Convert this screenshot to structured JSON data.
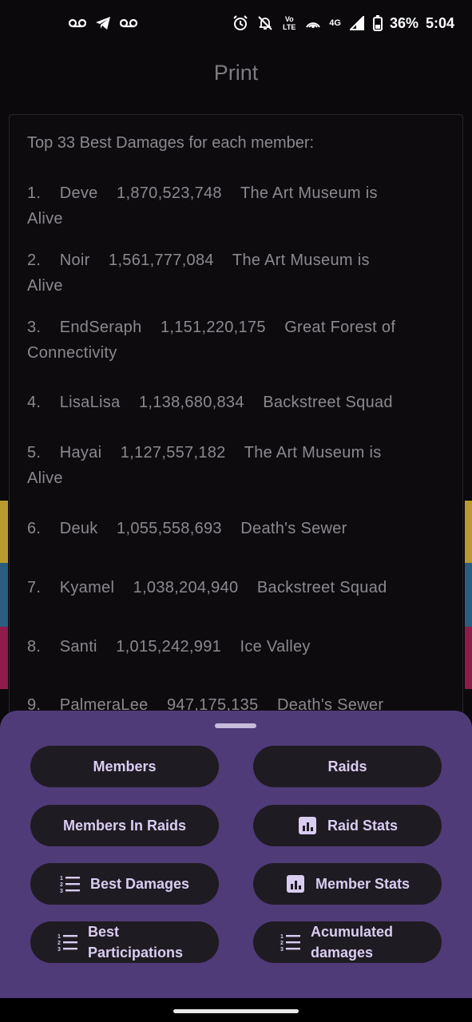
{
  "status_bar": {
    "battery": "36%",
    "time": "5:04",
    "network_label": "4G",
    "volte_label": "Vo LTE"
  },
  "title": "Print",
  "card": {
    "heading": "Top 33 Best Damages for each member:",
    "entries": [
      {
        "rank": "1.",
        "name": "Deve",
        "damage": "1,870,523,748",
        "raid_line1": "The Art Museum is",
        "raid_line2": "Alive"
      },
      {
        "rank": "2.",
        "name": "Noir",
        "damage": "1,561,777,084",
        "raid_line1": "The Art Museum is",
        "raid_line2": "Alive"
      },
      {
        "rank": "3.",
        "name": "EndSeraph",
        "damage": "1,151,220,175",
        "raid_line1": "Great Forest of",
        "raid_line2": "Connectivity"
      },
      {
        "rank": "4.",
        "name": "LisaLisa",
        "damage": "1,138,680,834",
        "raid_line1": "Backstreet Squad",
        "raid_line2": ""
      },
      {
        "rank": "5.",
        "name": "Hayai",
        "damage": "1,127,557,182",
        "raid_line1": "The Art Museum is",
        "raid_line2": "Alive"
      },
      {
        "rank": "6.",
        "name": "Deuk",
        "damage": "1,055,558,693",
        "raid_line1": "Death's Sewer",
        "raid_line2": ""
      },
      {
        "rank": "7.",
        "name": "Kyamel",
        "damage": "1,038,204,940",
        "raid_line1": "Backstreet Squad",
        "raid_line2": ""
      },
      {
        "rank": "8.",
        "name": "Santi",
        "damage": "1,015,242,991",
        "raid_line1": "Ice Valley",
        "raid_line2": ""
      },
      {
        "rank": "9.",
        "name": "PalmeraLee",
        "damage": "947,175,135",
        "raid_line1": "Death's Sewer",
        "raid_line2": ""
      }
    ]
  },
  "sheet": {
    "buttons": {
      "members": "Members",
      "raids": "Raids",
      "members_in_raids": "Members In Raids",
      "raid_stats": "Raid Stats",
      "best_damages": "Best Damages",
      "member_stats": "Member Stats",
      "best_participations_1": "Best",
      "best_participations_2": "Participations",
      "acumulated_damages_1": "Acumulated",
      "acumulated_damages_2": "damages"
    }
  },
  "colors": {
    "sheet_bg": "#4f3b78",
    "button_bg": "#1f1b22",
    "button_text": "#d9cdf2",
    "stripe_yellow": "#b89a2e",
    "stripe_blue": "#2a5d7e",
    "stripe_magenta": "#8e1c4a"
  }
}
